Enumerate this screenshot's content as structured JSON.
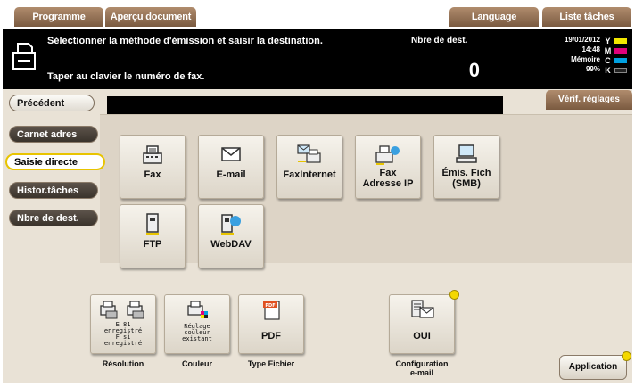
{
  "top_tabs": {
    "programme": "Programme",
    "apercu": "Aperçu document",
    "language": "Language",
    "liste": "Liste tâches"
  },
  "message": {
    "line1": "Sélectionner la méthode d'émission et saisir la destination.",
    "line2": "Taper au clavier le numéro de fax.",
    "dest_label": "Nbre de dest.",
    "dest_count": "0"
  },
  "status": {
    "date": "19/01/2012",
    "time": "14:48",
    "memory_label": "Mémoire",
    "memory_value": "99%",
    "toner": [
      {
        "letter": "Y",
        "color": "#f2e600"
      },
      {
        "letter": "M",
        "color": "#e0007a"
      },
      {
        "letter": "C",
        "color": "#00a0e0"
      },
      {
        "letter": "K",
        "color": "#222222"
      }
    ]
  },
  "nav": {
    "precedent": "Précédent",
    "verif": "Vérif. réglages",
    "carnet": "Carnet adres",
    "saisie": "Saisie directe",
    "histor": "Histor.tâches",
    "nbre": "Nbre de dest."
  },
  "methods": {
    "fax": "Fax",
    "email": "E-mail",
    "faxinternet": "FaxInternet",
    "fax_ip_1": "Fax",
    "fax_ip_2": "Adresse IP",
    "smb_1": "Émis. Fich",
    "smb_2": "(SMB)",
    "ftp": "FTP",
    "webdav": "WebDAV"
  },
  "settings": {
    "resolution_line1": "E 81",
    "resolution_line2": "enregistré",
    "resolution_line3": "F si",
    "resolution_line4": "enregistré",
    "resolution_caption": "Résolution",
    "color_line1": "Réglage",
    "color_line2": "couleur",
    "color_line3": "existant",
    "color_caption": "Couleur",
    "pdf_value": "PDF",
    "pdf_caption": "Type Fichier",
    "email_value": "OUI",
    "email_caption_1": "Configuration",
    "email_caption_2": "e-mail",
    "pdf_icon_text": "PDF"
  },
  "application": "Application"
}
